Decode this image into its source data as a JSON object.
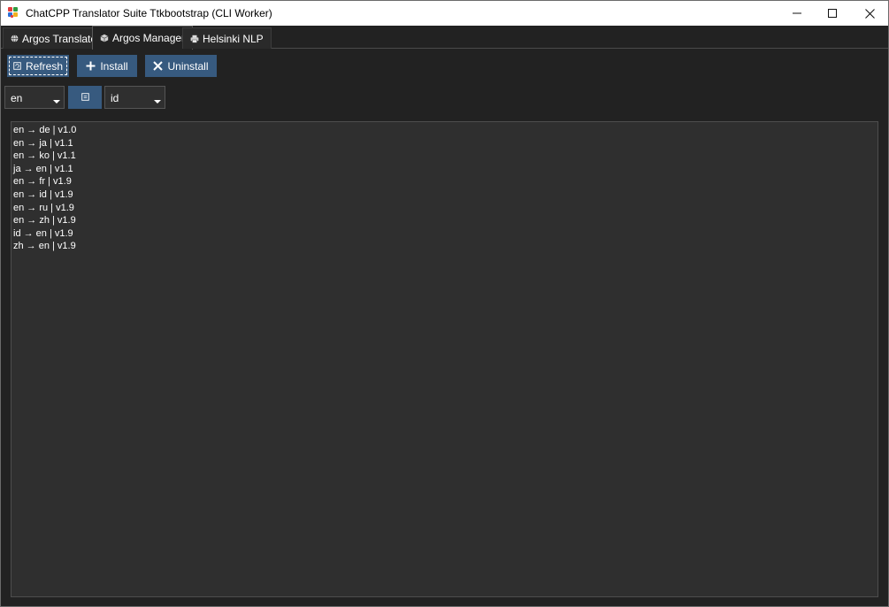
{
  "window": {
    "title": "ChatCPP Translator Suite Ttkbootstrap (CLI Worker)"
  },
  "tabs": [
    {
      "label": "Argos Translate",
      "active": false
    },
    {
      "label": "Argos Manager",
      "active": true
    },
    {
      "label": "Helsinki NLP",
      "active": false
    }
  ],
  "toolbar": {
    "refresh_label": "Refresh",
    "install_label": "Install",
    "uninstall_label": "Uninstall"
  },
  "languages": {
    "source": "en",
    "target": "id"
  },
  "packages": [
    "en → de | v1.0",
    "en → ja | v1.1",
    "en → ko | v1.1",
    "ja → en | v1.1",
    "en → fr | v1.9",
    "en → id | v1.9",
    "en → ru | v1.9",
    "en → zh | v1.9",
    "id → en | v1.9",
    "zh → en | v1.9"
  ],
  "colors": {
    "accent": "#375a7f",
    "background": "#222222",
    "panel": "#2f2f2f"
  },
  "icons": {
    "app": "app-logo-icon",
    "tab_translate": "globe-icon",
    "tab_manager": "package-icon",
    "tab_helsinki": "printer-icon",
    "refresh": "refresh-icon",
    "install": "plus-icon",
    "uninstall": "x-icon",
    "swap": "swap-icon"
  }
}
